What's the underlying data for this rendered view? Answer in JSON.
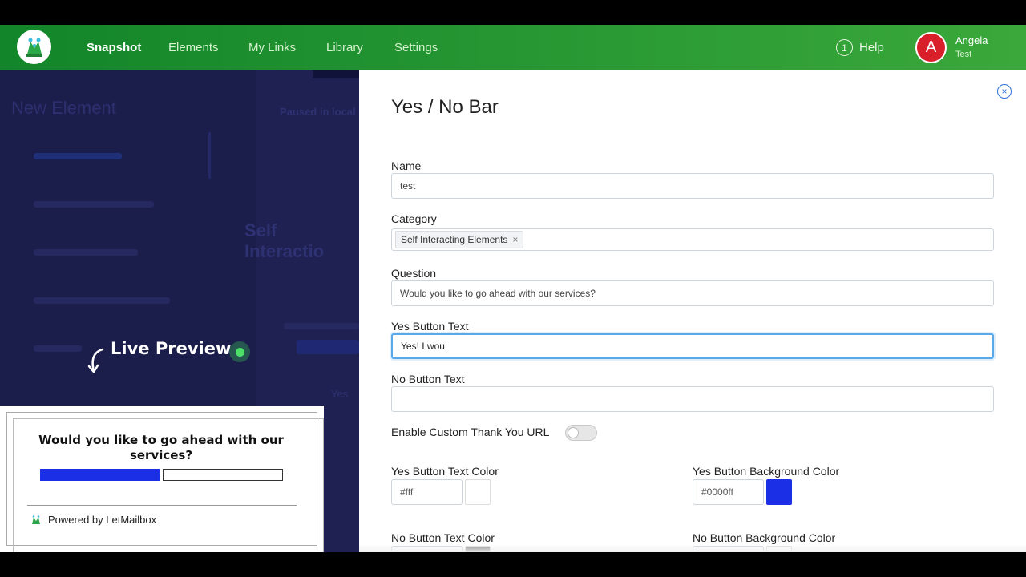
{
  "nav": {
    "links": [
      "Snapshot",
      "Elements",
      "My Links",
      "Library",
      "Settings"
    ],
    "help_icon": "1",
    "help": "Help",
    "avatar_letter": "A",
    "user_name": "Angela",
    "user_sub": "Test"
  },
  "background": {
    "title": "New Element",
    "paused_text": "Paused in local",
    "section_title": "Self Interactio",
    "yes_text": "Yes"
  },
  "live_preview": {
    "label": "Live Preview",
    "question": "Would you like to go ahead with our services?",
    "powered_by": "Powered by LetMailbox",
    "yes_bar_color": "#1a2fe6"
  },
  "form": {
    "title": "Yes / No Bar",
    "close_icon": "×",
    "name_label": "Name",
    "name_value": "test",
    "category_label": "Category",
    "category_tag": "Self Interacting Elements",
    "category_remove": "×",
    "question_label": "Question",
    "question_value": "Would you like to go ahead with our services?",
    "yes_text_label": "Yes Button Text",
    "yes_text_value": "Yes! I wou",
    "no_text_label": "No Button Text",
    "no_text_value": "",
    "thank_you_label": "Enable Custom Thank You URL",
    "thank_you_enabled": false,
    "yes_text_color_label": "Yes Button Text Color",
    "yes_text_color": "#fff",
    "yes_bg_color_label": "Yes Button Background Color",
    "yes_bg_color": "#0000ff",
    "no_text_color_label": "No Button Text Color",
    "no_text_color": "#333333",
    "no_bg_color_label": "No Button Background Color",
    "no_bg_color": "#fff"
  },
  "colors": {
    "nav_green": "#2a9a34",
    "overlay": "#1b1d4a",
    "focus_blue": "#5ba8e8",
    "avatar_red": "#d91f2a"
  }
}
